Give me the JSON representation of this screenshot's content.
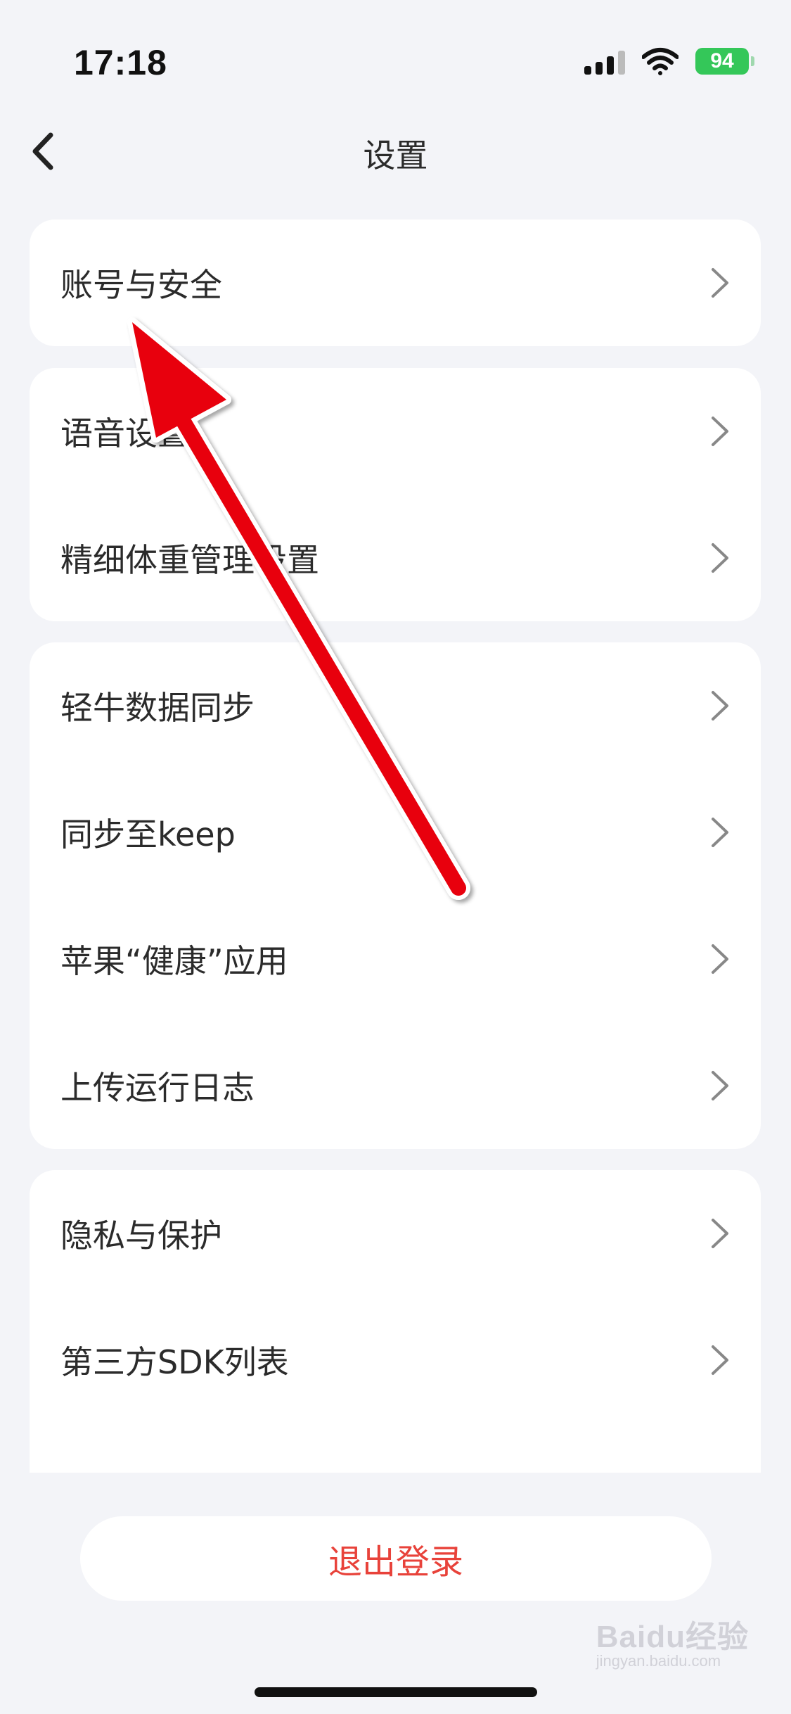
{
  "status_bar": {
    "time": "17:18",
    "battery": "94",
    "icons": [
      "signal-icon",
      "wifi-icon",
      "battery-icon"
    ]
  },
  "nav": {
    "title": "设置",
    "back_icon": "chevron-left-icon"
  },
  "sections": [
    {
      "items": [
        {
          "label": "账号与安全"
        }
      ]
    },
    {
      "items": [
        {
          "label": "语音设置"
        },
        {
          "label": "精细体重管理设置"
        }
      ]
    },
    {
      "items": [
        {
          "label": "轻牛数据同步"
        },
        {
          "label": "同步至keep"
        },
        {
          "label": "苹果“健康”应用"
        },
        {
          "label": "上传运行日志"
        }
      ]
    },
    {
      "items": [
        {
          "label": "隐私与保护"
        },
        {
          "label": "第三方SDK列表"
        }
      ]
    }
  ],
  "logout": {
    "label": "退出登录"
  },
  "watermark": {
    "brand": "Baidu经验",
    "url": "jingyan.baidu.com"
  },
  "colors": {
    "background": "#f3f4f8",
    "logout_text": "#e8423a",
    "battery": "#34c759",
    "annotation_arrow": "#e8000b"
  }
}
